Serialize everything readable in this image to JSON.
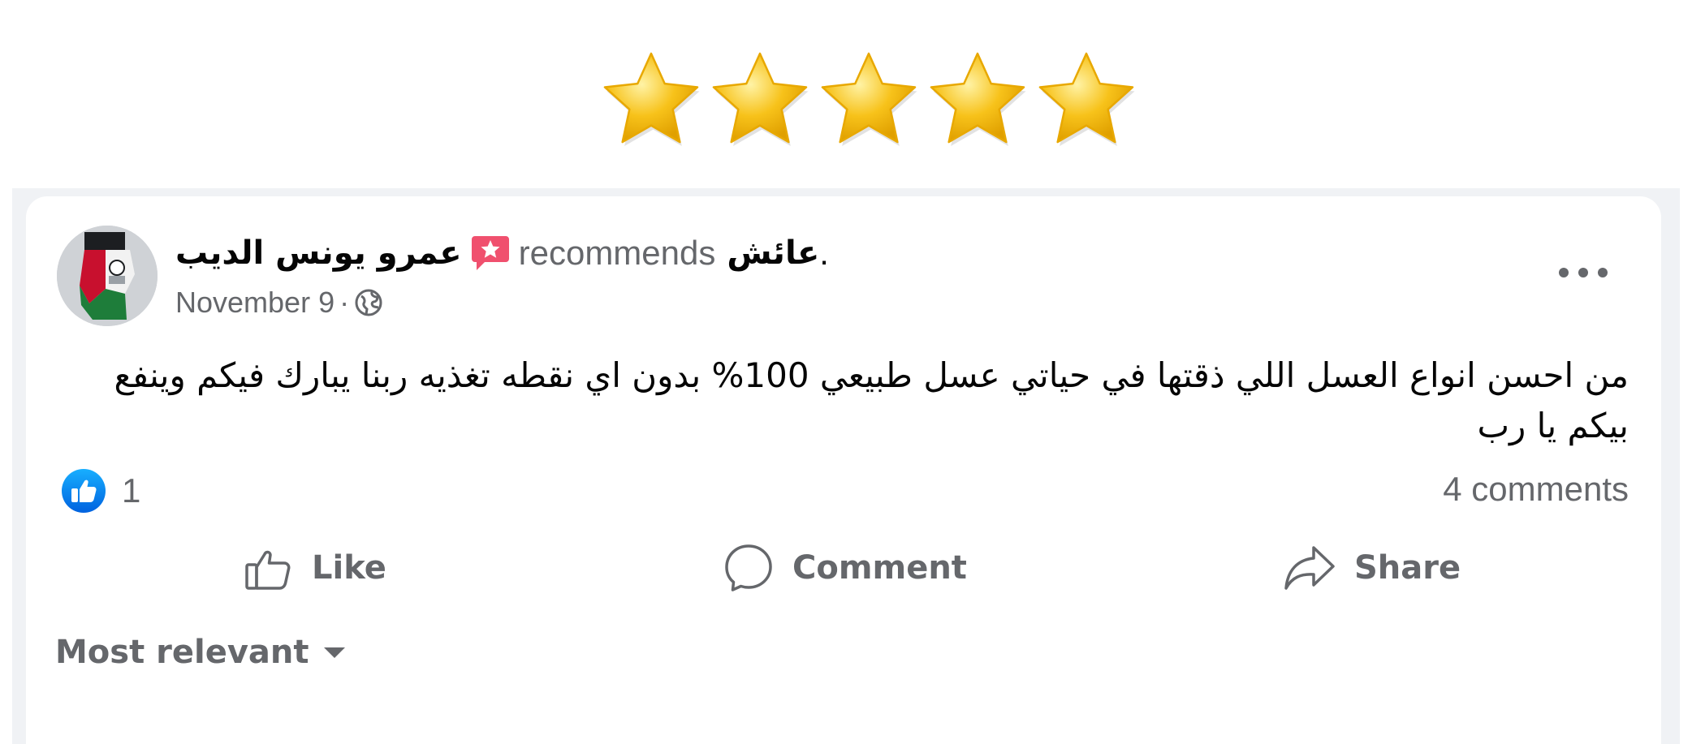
{
  "rating": {
    "stars": 5,
    "max": 5
  },
  "post": {
    "author": "عمرو يونس الديب",
    "badge_icon": "recommend-star-badge-icon",
    "verb": "recommends",
    "page_name": "عائش",
    "period": ".",
    "date": "November 9",
    "separator": "·",
    "privacy_icon": "globe-icon",
    "menu_icon": "more-options-icon",
    "text": "من احسن انواع العسل اللي ذقتها في حياتي عسل طبيعي 100% بدون  اي نقطه تغذيه ربنا يبارك فيكم وينفع بيكم يا رب",
    "reaction_icon": "like-badge-icon",
    "reaction_count": "1",
    "comments_count": "4 comments"
  },
  "actions": {
    "like_label": "Like",
    "comment_label": "Comment",
    "share_label": "Share"
  },
  "comments_sort": {
    "label": "Most relevant"
  },
  "colors": {
    "star": "#f7c21a",
    "secondary_text": "#65676b",
    "primary_text": "#050505",
    "like_blue": "#1877f2",
    "badge_pink": "#f0506e",
    "feed_background": "#f0f2f5"
  }
}
